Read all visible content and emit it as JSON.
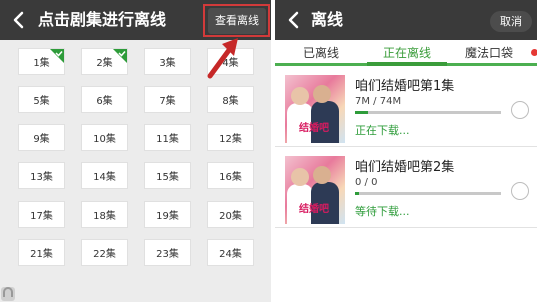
{
  "left": {
    "title": "点击剧集进行离线",
    "view_button": "查看离线",
    "episodes": [
      {
        "label": "1集",
        "checked": true
      },
      {
        "label": "2集",
        "checked": true
      },
      {
        "label": "3集",
        "checked": false
      },
      {
        "label": "4集",
        "checked": false
      },
      {
        "label": "5集",
        "checked": false
      },
      {
        "label": "6集",
        "checked": false
      },
      {
        "label": "7集",
        "checked": false
      },
      {
        "label": "8集",
        "checked": false
      },
      {
        "label": "9集",
        "checked": false
      },
      {
        "label": "10集",
        "checked": false
      },
      {
        "label": "11集",
        "checked": false
      },
      {
        "label": "12集",
        "checked": false
      },
      {
        "label": "13集",
        "checked": false
      },
      {
        "label": "14集",
        "checked": false
      },
      {
        "label": "15集",
        "checked": false
      },
      {
        "label": "16集",
        "checked": false
      },
      {
        "label": "17集",
        "checked": false
      },
      {
        "label": "18集",
        "checked": false
      },
      {
        "label": "19集",
        "checked": false
      },
      {
        "label": "20集",
        "checked": false
      },
      {
        "label": "21集",
        "checked": false
      },
      {
        "label": "22集",
        "checked": false
      },
      {
        "label": "23集",
        "checked": false
      },
      {
        "label": "24集",
        "checked": false
      }
    ]
  },
  "right": {
    "title": "离线",
    "cancel_button": "取消",
    "tabs": [
      {
        "label": "已离线",
        "active": false
      },
      {
        "label": "正在离线",
        "active": true
      },
      {
        "label": "魔法口袋",
        "active": false
      }
    ],
    "downloads": [
      {
        "title": "咱们结婚吧第1集",
        "size": "7M / 74M",
        "progress": 0.09,
        "status": "正在下载..."
      },
      {
        "title": "咱们结婚吧第2集",
        "size": "0 / 0",
        "progress": 0.03,
        "status": "等待下载..."
      }
    ]
  },
  "colors": {
    "topbar": "#3a3a3a",
    "accent_green": "#2e9c3a",
    "highlight_red": "#d23a3a",
    "tab_dot": "#e53935"
  }
}
